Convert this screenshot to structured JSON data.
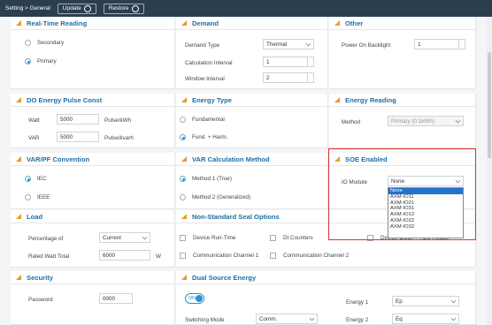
{
  "topbar": {
    "breadcrumb": "Setting > General",
    "update": "Update",
    "restore": "Restore"
  },
  "realtime": {
    "title": "Real-Time Reading",
    "opt1": "Secondary",
    "opt2": "Primary"
  },
  "demand": {
    "title": "Demand",
    "type_label": "Demand Type",
    "type_value": "Thermal",
    "calc_label": "Calculation Interval",
    "calc_value": "1",
    "window_label": "Window Interval",
    "window_value": "2"
  },
  "other": {
    "title": "Other",
    "backlight_label": "Power On Backlight",
    "backlight_value": "1"
  },
  "pulse": {
    "title": "DO Energy Pulse Const",
    "watt_label": "Watt",
    "watt_value": "5000",
    "watt_unit": "Pulse/kWh",
    "var_label": "VAR",
    "var_value": "5000",
    "var_unit": "Pulse/kvarh"
  },
  "energytype": {
    "title": "Energy Type",
    "opt1": "Fundamental",
    "opt2": "Fund. + Harm."
  },
  "energyreading": {
    "title": "Energy Reading",
    "method_label": "Method",
    "method_value": "Primary (0.1kWh)"
  },
  "varpf": {
    "title": "VAR/PF Convention",
    "opt1": "IEC",
    "opt2": "IEEE"
  },
  "varcalc": {
    "title": "VAR Calculation Method",
    "opt1": "Method 1 (True)",
    "opt2": "Method 2 (Generalized)"
  },
  "soe": {
    "title": "SOE Enabled",
    "io_label": "IO Module",
    "io_value": "None",
    "options": [
      "None",
      "AXM-IO11",
      "AXM-IO21",
      "AXM-IO31",
      "AXM-IO12",
      "AXM-IO22",
      "AXM-IO32"
    ]
  },
  "load": {
    "title": "Load",
    "pct_label": "Percentage of",
    "pct_value": "Current",
    "rated_label": "Rated Watt Total",
    "rated_value": "6000",
    "rated_unit": "W"
  },
  "seal": {
    "title": "Non-Standard Seal Options",
    "o1": "Device Run-Time",
    "o2": "DI Counters",
    "o3": "Device Clock + TOU Rotate",
    "o4": "Communication Channel 1",
    "o5": "Communication Channel 2"
  },
  "security": {
    "title": "Security",
    "pw_label": "Password",
    "pw_value": "0000"
  },
  "dual": {
    "title": "Dual Source Energy",
    "toggle": "ON",
    "mode_label": "Switching Mode",
    "mode_value": "Comm.",
    "e1_label": "Energy 1",
    "e1_value": "Ep",
    "e2_label": "Energy 2",
    "e2_value": "Eq"
  }
}
